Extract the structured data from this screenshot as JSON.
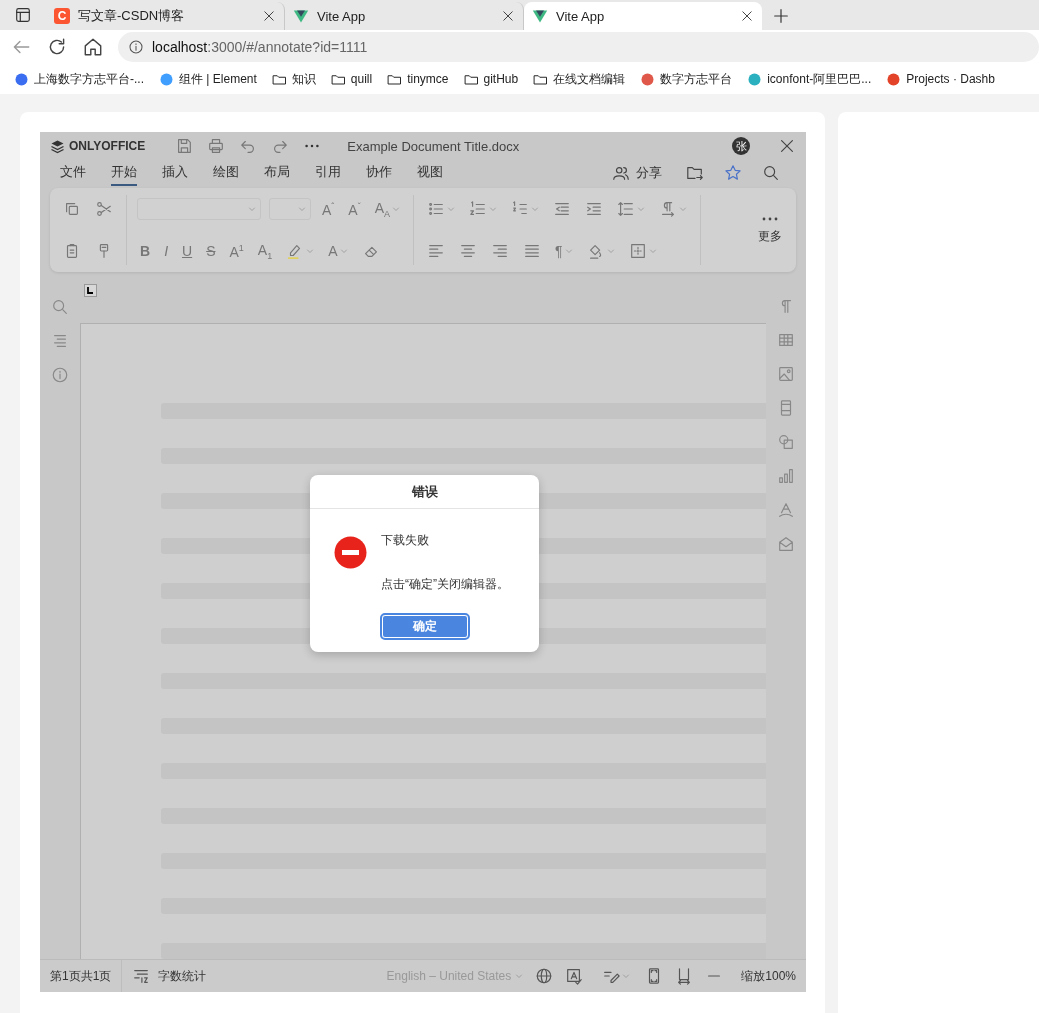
{
  "browser": {
    "tabs": [
      {
        "kind": "csdn",
        "icon_letter": "C",
        "title": "写文章-CSDN博客",
        "selected": false
      },
      {
        "kind": "vite",
        "title": "Vite App",
        "selected": false
      },
      {
        "kind": "vite",
        "title": "Vite App",
        "selected": true
      }
    ],
    "address": {
      "host": "localhost",
      "path": ":3000/#/annotate?id=1111"
    },
    "bookmarks": [
      {
        "kind": "site",
        "color": "#3b6df0",
        "label": "上海数字方志平台-..."
      },
      {
        "kind": "site",
        "color": "#409eff",
        "label": "组件 | Element"
      },
      {
        "kind": "folder",
        "label": "知识"
      },
      {
        "kind": "folder",
        "label": "quill"
      },
      {
        "kind": "folder",
        "label": "tinymce"
      },
      {
        "kind": "folder",
        "label": "gitHub"
      },
      {
        "kind": "folder",
        "label": "在线文档编辑"
      },
      {
        "kind": "site",
        "color": "#e0584a",
        "label": "数字方志平台"
      },
      {
        "kind": "site",
        "color": "#2bb0c0",
        "label": "iconfont-阿里巴巴..."
      },
      {
        "kind": "site",
        "color": "#e24329",
        "label": "Projects · Dashb"
      }
    ]
  },
  "editor": {
    "logo": "ONLYOFFICE",
    "title": "Example Document Title.docx",
    "avatar": "张",
    "menu": [
      {
        "label": "文件",
        "selected": false
      },
      {
        "label": "开始",
        "selected": true
      },
      {
        "label": "插入",
        "selected": false
      },
      {
        "label": "绘图",
        "selected": false
      },
      {
        "label": "布局",
        "selected": false
      },
      {
        "label": "引用",
        "selected": false
      },
      {
        "label": "协作",
        "selected": false
      },
      {
        "label": "视图",
        "selected": false
      }
    ],
    "share": "分享",
    "toolbar": {
      "groups": [
        {
          "row1": [
            {
              "kind": "copy",
              "caret": false
            },
            {
              "kind": "cut",
              "caret": false
            }
          ],
          "row2": [
            {
              "kind": "paste",
              "caret": false
            },
            {
              "kind": "painter",
              "caret": false
            }
          ]
        },
        {
          "row1": [
            {
              "kind": "fontcombo",
              "caret": true
            },
            {
              "kind": "sizecombo",
              "caret": true
            },
            {
              "kind": "glyph",
              "text": "A$^{ˆ}$",
              "caret": false
            },
            {
              "kind": "glyph",
              "text": "A$^{ˇ}$",
              "caret": false
            },
            {
              "kind": "glyph",
              "text": "A$_{A}$",
              "caret": true
            }
          ],
          "row2": [
            {
              "kind": "bold",
              "text": "B",
              "caret": false
            },
            {
              "kind": "italic",
              "text": "I",
              "caret": false
            },
            {
              "kind": "underline",
              "text": "U",
              "caret": false
            },
            {
              "kind": "strike",
              "text": "S",
              "caret": false
            },
            {
              "kind": "glyph",
              "text": "A$^{1}$",
              "caret": false
            },
            {
              "kind": "glyph",
              "text": "A$_{1}$",
              "caret": false
            },
            {
              "kind": "highlight",
              "caret": true
            },
            {
              "kind": "glyph",
              "text": "A",
              "caret": true
            },
            {
              "kind": "eraser",
              "caret": false
            }
          ]
        },
        {
          "row1": [
            {
              "kind": "bullets",
              "caret": true
            },
            {
              "kind": "numbering",
              "caret": true
            },
            {
              "kind": "multilevel",
              "caret": true
            },
            {
              "kind": "outdent",
              "caret": false
            },
            {
              "kind": "indent",
              "caret": false
            },
            {
              "kind": "spacing",
              "caret": true
            },
            {
              "kind": "direction",
              "caret": true
            }
          ],
          "row2": [
            {
              "kind": "left",
              "caret": false
            },
            {
              "kind": "center",
              "caret": false
            },
            {
              "kind": "right",
              "caret": false
            },
            {
              "kind": "justify",
              "caret": false
            },
            {
              "kind": "glyph",
              "text": "¶",
              "caret": true
            },
            {
              "kind": "shading",
              "caret": true
            },
            {
              "kind": "borders",
              "caret": true
            }
          ]
        }
      ],
      "more": "更多"
    },
    "dialog": {
      "title": "错误",
      "message": "下载失败",
      "hint": "点击“确定”关闭编辑器。",
      "button": "确定"
    },
    "status": {
      "pages": "第1页共1页",
      "word_count": "字数统计",
      "language": {
        "text": "English – United States",
        "disabled": true
      },
      "zoom": "缩放100%"
    }
  }
}
